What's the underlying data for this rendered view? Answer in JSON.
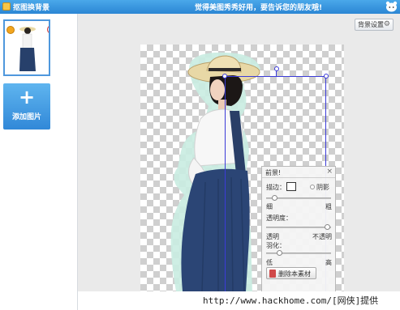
{
  "titlebar": {
    "app_title": "抠图换背景",
    "promo_text": "觉得美图秀秀好用，要告诉您的朋友哦!"
  },
  "sidebar": {
    "add_label": "添加图片",
    "add_symbol": "+",
    "delete_symbol": "×"
  },
  "toolbar": {
    "bg_settings_label": "背景设置",
    "bg_settings_icon": "⚙"
  },
  "panel": {
    "title": "前景!",
    "close_symbol": "×",
    "stroke_label": "描边：",
    "shadow_label": "阴影",
    "thin_label": "细",
    "thick_label": "粗",
    "opacity_label": "透明度：",
    "transparent_label": "透明",
    "opaque_label": "不透明",
    "feather_label": "羽化：",
    "low_label": "低",
    "high_label": "高",
    "delete_label": "删除本素材",
    "stroke_width": 0.0,
    "opacity": 1.0,
    "feather": 0.3
  },
  "watermark": "http://www.hackhome.com/[网侠]提供",
  "colors": {
    "titlebar": "#2b86d4",
    "accent": "#4f98dd",
    "selection": "#3b3bd8"
  }
}
